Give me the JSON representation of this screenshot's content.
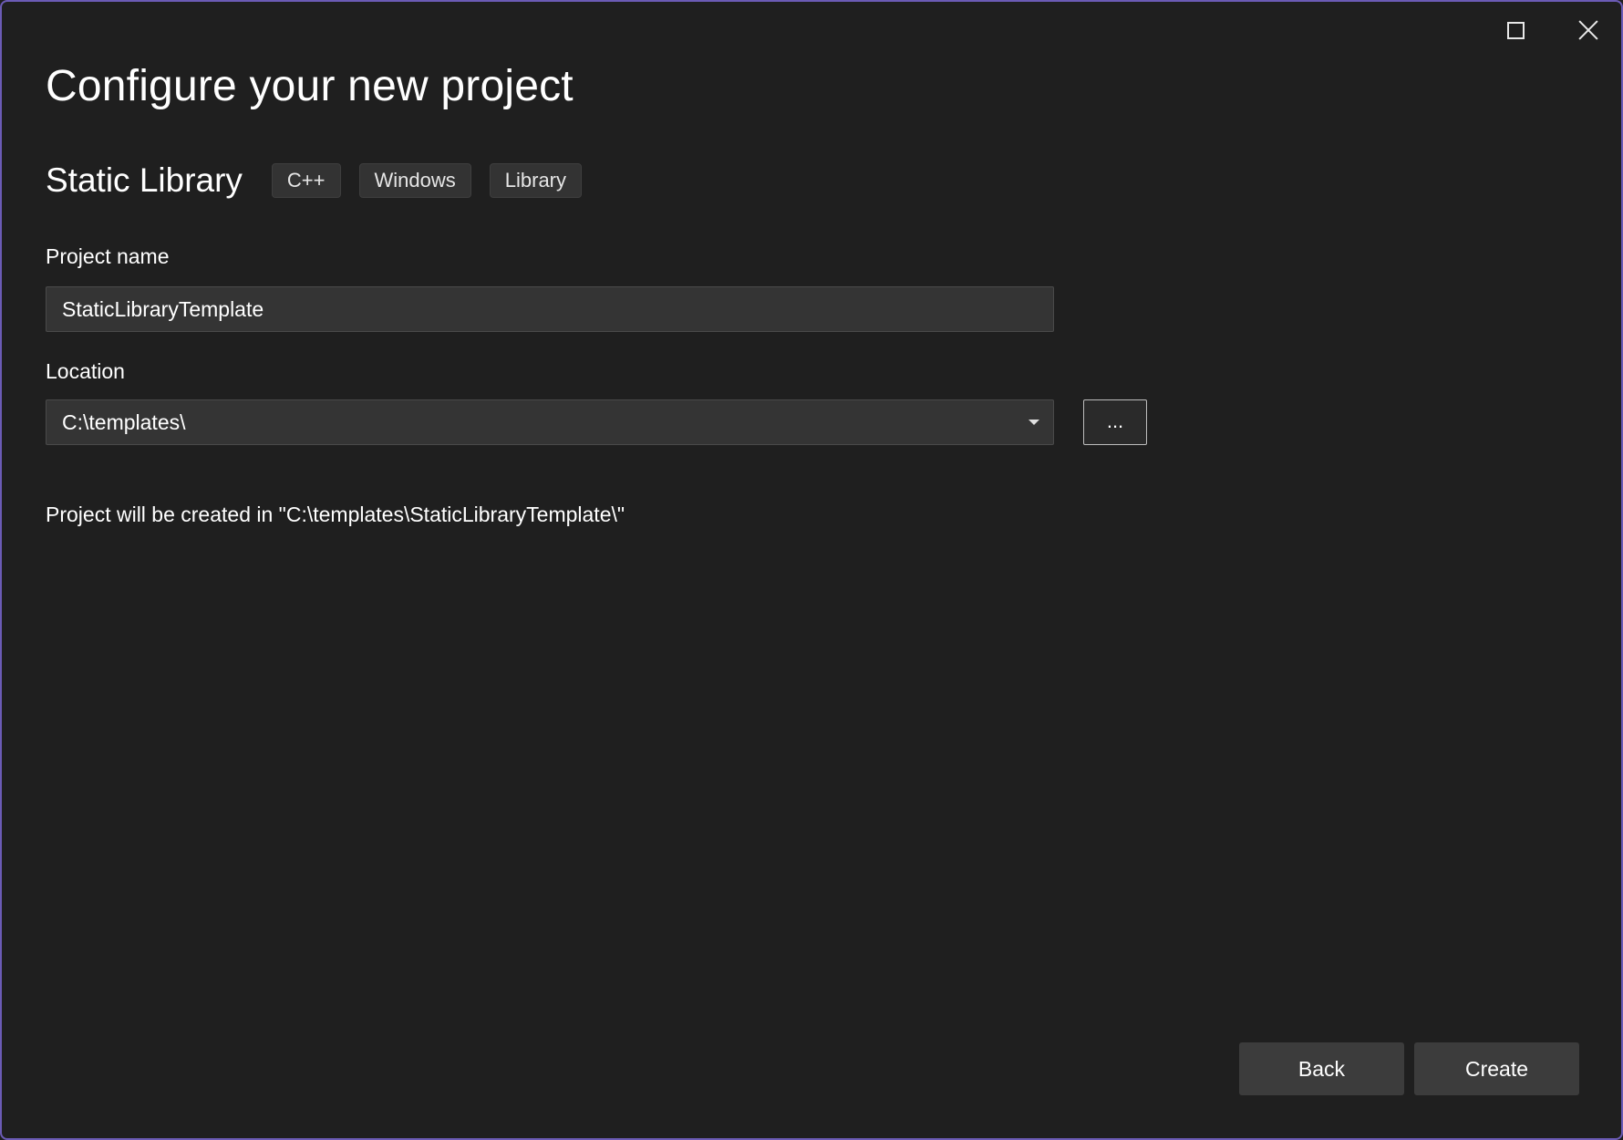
{
  "window": {
    "caption_buttons": {
      "maximize_icon": "maximize-icon",
      "close_icon": "close-icon"
    }
  },
  "header": {
    "title": "Configure your new project"
  },
  "template": {
    "name": "Static Library",
    "tags": [
      "C++",
      "Windows",
      "Library"
    ]
  },
  "form": {
    "project_name": {
      "label": "Project name",
      "value": "StaticLibraryTemplate"
    },
    "location": {
      "label": "Location",
      "value": "C:\\templates\\",
      "dropdown_icon": "chevron-down-icon",
      "browse_label": "..."
    },
    "created_path_text": "Project will be created in \"C:\\templates\\StaticLibraryTemplate\\\""
  },
  "footer": {
    "back_label": "Back",
    "create_label": "Create"
  },
  "colors": {
    "background": "#1f1f1f",
    "window_border": "#6b5bb5",
    "input_background": "#343434",
    "button_background": "#3c3c3c",
    "tag_background": "#333333",
    "text": "#ffffff"
  }
}
